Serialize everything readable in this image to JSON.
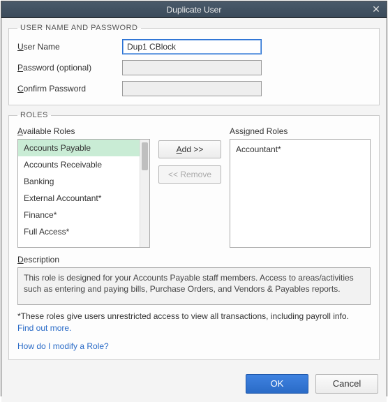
{
  "title": "Duplicate User",
  "section1": {
    "legend": "USER NAME AND PASSWORD",
    "username_label_u": "U",
    "username_label_rest": "ser Name",
    "username_value": "Dup1 CBlock",
    "password_label_u": "P",
    "password_label_rest": "assword (optional)",
    "password_value": "",
    "confirm_label_u": "C",
    "confirm_label_rest": "onfirm Password",
    "confirm_value": ""
  },
  "roles": {
    "legend": "ROLES",
    "available_label_u": "A",
    "available_label_rest": "vailable Roles",
    "assigned_label_u": "A",
    "assigned_label_rest": "ss",
    "assigned_label_u2": "i",
    "assigned_label_rest2": "gned Roles",
    "available": [
      {
        "label": "Accounts Payable",
        "selected": true
      },
      {
        "label": "Accounts Receivable",
        "selected": false
      },
      {
        "label": "Banking",
        "selected": false
      },
      {
        "label": "External Accountant*",
        "selected": false
      },
      {
        "label": "Finance*",
        "selected": false
      },
      {
        "label": "Full Access*",
        "selected": false
      }
    ],
    "assigned": [
      {
        "label": "Accountant*"
      }
    ],
    "add_u": "A",
    "add_rest": "dd >>",
    "remove": "<< Remove",
    "desc_label_u": "D",
    "desc_label_rest": "escription",
    "description": "This role is designed for your Accounts Payable staff members. Access to areas/activities such as entering and paying bills, Purchase Orders, and Vendors & Payables reports.",
    "note": "*These roles give users unrestricted access to view all transactions, including payroll info.",
    "find_out_more": "Find out more.",
    "modify_link": "How do I modify a Role?"
  },
  "footer": {
    "ok": "OK",
    "cancel": "Cancel"
  }
}
